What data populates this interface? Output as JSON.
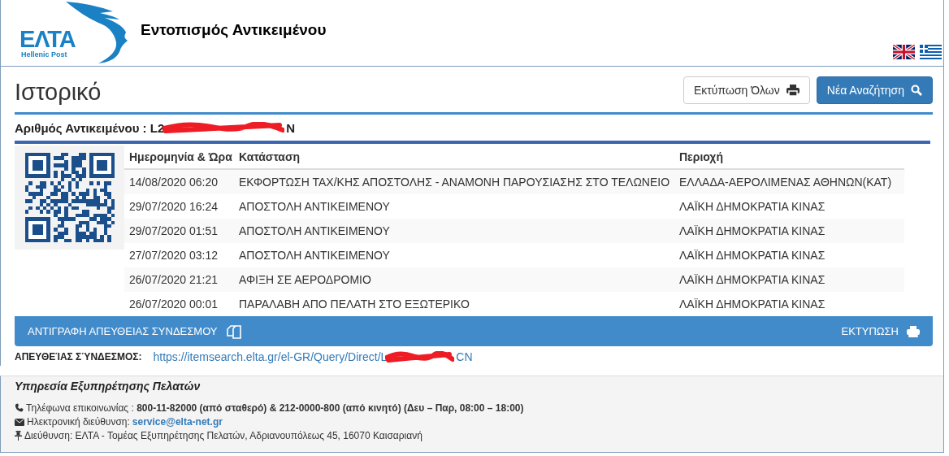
{
  "header": {
    "logo_text": "ΕΛΤΑ",
    "logo_subtitle": "Hellenic Post",
    "title": "Εντοπισμός Αντικειμένου",
    "languages": [
      {
        "kind": "uk"
      },
      {
        "kind": "gr"
      }
    ]
  },
  "page": {
    "heading": "Ιστορικό",
    "buttons": [
      {
        "label": "Εκτύπωση Όλων",
        "kind": "outline"
      },
      {
        "label": "Νέα Αναζήτηση",
        "kind": "primary"
      }
    ]
  },
  "item": {
    "label": "Αριθμός Αντικειμένου : L2",
    "suffix": "N"
  },
  "table": {
    "columns": [
      "Ημερομηνία & Ώρα",
      "Κατάσταση",
      "Περιοχή"
    ],
    "rows": [
      [
        "14/08/2020 06:20",
        "ΕΚΦΟΡΤΩΣΗ ΤΑΧ/ΚΗΣ ΑΠΟΣΤΟΛΗΣ - ΑΝΑΜΟΝΗ ΠΑΡΟΥΣΙΑΣΗΣ ΣΤΟ ΤΕΛΩΝΕΙΟ",
        "ΕΛΛΑΔΑ-ΑΕΡΟΛΙΜΕΝΑΣ ΑΘΗΝΩΝ(ΚΑΤ)"
      ],
      [
        "29/07/2020 16:24",
        "ΑΠΟΣΤΟΛΗ ΑΝΤΙΚΕΙΜΕΝΟΥ",
        "ΛΑΪΚΗ ΔΗΜΟΚΡΑΤΙΑ ΚΙΝΑΣ"
      ],
      [
        "29/07/2020 01:51",
        "ΑΠΟΣΤΟΛΗ ΑΝΤΙΚΕΙΜΕΝΟΥ",
        "ΛΑΪΚΗ ΔΗΜΟΚΡΑΤΙΑ ΚΙΝΑΣ"
      ],
      [
        "27/07/2020 03:12",
        "ΑΠΟΣΤΟΛΗ ΑΝΤΙΚΕΙΜΕΝΟΥ",
        "ΛΑΪΚΗ ΔΗΜΟΚΡΑΤΙΑ ΚΙΝΑΣ"
      ],
      [
        "26/07/2020 21:21",
        "ΑΦΙΞΗ ΣΕ ΑΕΡΟΔΡΟΜΙΟ",
        "ΛΑΪΚΗ ΔΗΜΟΚΡΑΤΙΑ ΚΙΝΑΣ"
      ],
      [
        "26/07/2020 00:01",
        "ΠΑΡΑΛΑΒΗ ΑΠΟ ΠΕΛΑΤΗ ΣΤΟ ΕΞΩΤΕΡΙΚΟ",
        "ΛΑΪΚΗ ΔΗΜΟΚΡΑΤΙΑ ΚΙΝΑΣ"
      ]
    ]
  },
  "action_bar": {
    "copy_link": "ΑΝΤΙΓΡΑΦΗ ΑΠΕΥΘΕΙΑΣ ΣΥΝΔΕΣΜΟΥ",
    "print": "ΕΚΤΥΠΩΣΗ"
  },
  "direct_link": {
    "label": "ΑΠΕΥΘΕΊΑΣ ΣΎΝΔΕΣΜΟΣ:",
    "url_start": "https://itemsearch.elta.gr/el-GR/Query/Direct/L",
    "url_end": "CN"
  },
  "footer": {
    "title": "Υπηρεσία Εξυπηρέτησης Πελατών",
    "lines": [
      {
        "kind": "phone",
        "text": "Τηλέφωνα επικοινωνίας : **800-11-82000 (από σταθερό) & 212-0000-800 (από κινητό) (Δευ – Παρ, 08:00 – 18:00)**"
      },
      {
        "kind": "email",
        "text": "Ηλεκτρονική διεύθυνση:",
        "link": "service@elta-net.gr"
      },
      {
        "kind": "pin",
        "text": "Διεύθυνση: ΕΛΤΑ - Τομέας Εξυπηρέτησης Πελατών, Αδριανουπόλεως 45, 16070 Καισαριανή"
      }
    ]
  }
}
